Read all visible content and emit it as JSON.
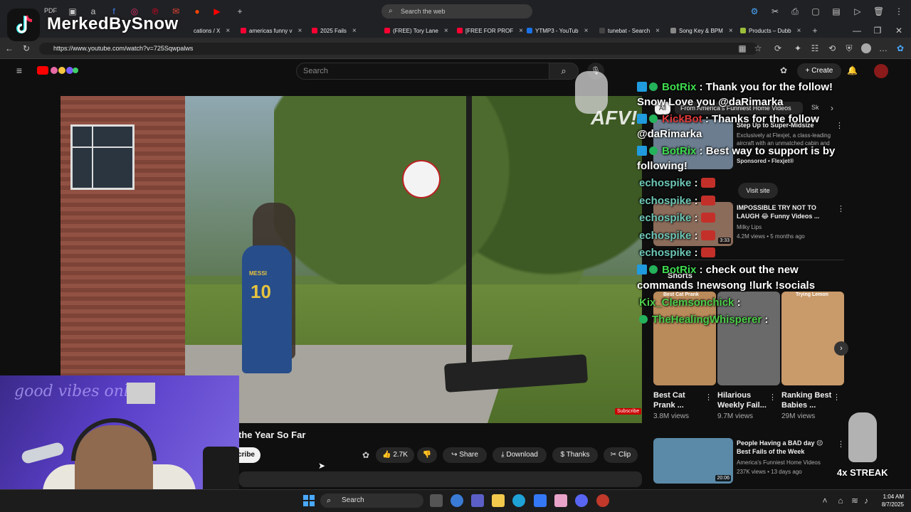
{
  "browser": {
    "web_search_placeholder": "Search the web",
    "url": "https://www.youtube.com/watch?v=725Sqwpalws",
    "tabs": [
      {
        "label": "cations / X"
      },
      {
        "label": "americas funny v"
      },
      {
        "label": "2025 Fails"
      },
      {
        "label": "(FREE) Tory Lane"
      },
      {
        "label": "[FREE FOR PROF"
      },
      {
        "label": "YTMP3 - YouTub"
      },
      {
        "label": "tunebat - Search"
      },
      {
        "label": "Song Key & BPM"
      },
      {
        "label": "Products – Dubb"
      }
    ],
    "pinned_label": "PDF"
  },
  "overlay": {
    "streamer_name": "MerkedBySnow",
    "streak": "4x STREAK"
  },
  "youtube": {
    "search_placeholder": "Search",
    "create_label": "Create",
    "video": {
      "title_partial": "the Year So Far",
      "jersey_name": "MESSI",
      "jersey_number": "10",
      "watermark": "AFV!",
      "subscribe_watermark": "Subscribe",
      "subscribe_label": "cribe",
      "likes": "2.7K",
      "share_label": "Share",
      "download_label": "Download",
      "thanks_label": "Thanks",
      "clip_label": "Clip"
    },
    "chips": {
      "all": "All",
      "channel": "From America's Funniest Home Videos",
      "next": "Sk"
    },
    "ad": {
      "title": "Step Up to Super-Midsize",
      "desc": "Exclusively at Flexjet, a class-leading aircraft with an unmatched cabin and",
      "sponsor": "Sponsored • Flexjet®",
      "cta": "Visit site"
    },
    "recs": [
      {
        "title": "IMPOSSIBLE TRY NOT TO LAUGH 😂 Funny Videos ...",
        "channel": "Milky Lips",
        "meta": "4.2M views • 5 months ago",
        "duration": "3:33"
      },
      {
        "title": "People Having a BAD day 😔 Best Fails of the Week",
        "channel": "America's Funniest Home Videos",
        "meta": "237K views • 13 days ago",
        "duration": "20:06"
      }
    ],
    "shorts_label": "Shorts",
    "shorts": [
      {
        "title": "Best Cat Prank ...",
        "views": "3.8M views",
        "thumb_text": "Best Cat Prank"
      },
      {
        "title": "Hilarious Weekly Fail...",
        "views": "9.7M views",
        "thumb_text": ""
      },
      {
        "title": "Ranking Best Babies ...",
        "views": "29M views",
        "thumb_text": "Trying Lemon"
      }
    ]
  },
  "chat": [
    {
      "user": "BotRix",
      "text": ": Thank you for the follow!"
    },
    {
      "user": "",
      "text": "Snow Love you @daRimarka"
    },
    {
      "user": "KickBot",
      "text": ": Thanks for the follow"
    },
    {
      "user": "",
      "text": "@daRimarka"
    },
    {
      "user": "BotRix",
      "text": ": Best way to support is by"
    },
    {
      "user": "",
      "text": "following!"
    },
    {
      "user": "echospike",
      "text": ":"
    },
    {
      "user": "echospike",
      "text": ":"
    },
    {
      "user": "echospike",
      "text": ":"
    },
    {
      "user": "echospike",
      "text": ":"
    },
    {
      "user": "echospike",
      "text": ":"
    },
    {
      "user": "BotRix",
      "text": ": check out the new"
    },
    {
      "user": "",
      "text": "commands !newsong !lurk !socials"
    },
    {
      "user": "Kix_Clemsonchick",
      "text": ":"
    },
    {
      "user": "TheHealingWhisperer",
      "text": ":"
    }
  ],
  "webcam": {
    "neon_text": "good vibes only"
  },
  "taskbar": {
    "search_label": "Search",
    "time": "1:04 AM",
    "date": "8/7/2025"
  }
}
